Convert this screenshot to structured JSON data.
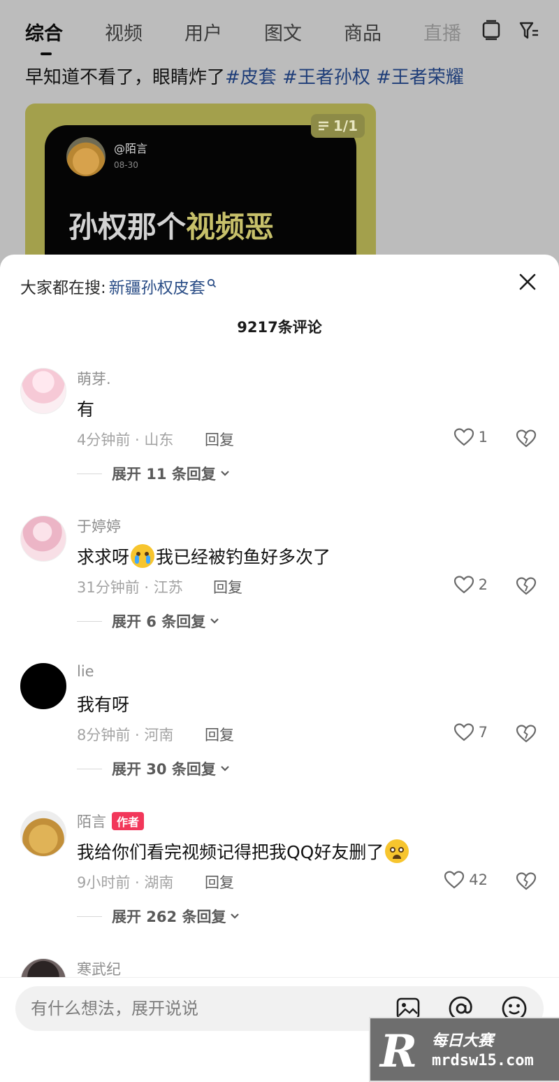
{
  "tabs": [
    {
      "label": "综合",
      "active": true
    },
    {
      "label": "视频"
    },
    {
      "label": "用户"
    },
    {
      "label": "图文"
    },
    {
      "label": "商品"
    },
    {
      "label": "直播"
    }
  ],
  "tab_icons": [
    "stack-icon",
    "filter-icon"
  ],
  "post": {
    "title_text": "早知道不看了，眼睛炸了",
    "hashtags": [
      "#皮套",
      "#王者孙权",
      "#王者荣耀"
    ],
    "card": {
      "username": "@陌言",
      "date": "08-30",
      "headline_plain": "孙权那个",
      "headline_highlight": "视频恶",
      "counter": "1/1"
    }
  },
  "sheet": {
    "search_prefix": "大家都在搜:",
    "search_keyword": "新疆孙权皮套",
    "comment_count": "9217条评论"
  },
  "comments": [
    {
      "user": "萌芽.",
      "avatar": "anime-girl",
      "text": "有",
      "meta": "4分钟前 · 山东",
      "reply": "回复",
      "likes": "1",
      "expand": "展开 11 条回复"
    },
    {
      "user": "于婷婷",
      "avatar": "anime-girl",
      "text_before": "求求呀",
      "emoji": "crying-emoji",
      "text_after": "我已经被钓鱼好多次了",
      "meta": "31分钟前 · 江苏",
      "reply": "回复",
      "likes": "2",
      "expand": "展开 6 条回复"
    },
    {
      "user": "lie",
      "avatar": "black",
      "text": "我有呀",
      "meta": "8分钟前 · 河南",
      "reply": "回复",
      "likes": "7",
      "expand": "展开 30 条回复"
    },
    {
      "user": "陌言",
      "badge": "作者",
      "avatar": "dog",
      "text": "我给你们看完视频记得把我QQ好友删了",
      "emoji": "pleading-emoji",
      "meta": "9小时前 · 湖南",
      "reply": "回复",
      "likes": "42",
      "expand": "展开 262 条回复"
    },
    {
      "user": "寒武纪",
      "avatar": "dark"
    }
  ],
  "input": {
    "placeholder": "有什么想法，展开说说"
  },
  "input_icons": [
    "image-icon",
    "at-icon",
    "emoji-icon"
  ],
  "watermark": {
    "line1": "每日大赛",
    "line2": "mrdsw15.com"
  },
  "colors": {
    "link": "#2a4d86",
    "author_badge": "#f2375a",
    "dim_overlay": "#bcbcbc"
  }
}
